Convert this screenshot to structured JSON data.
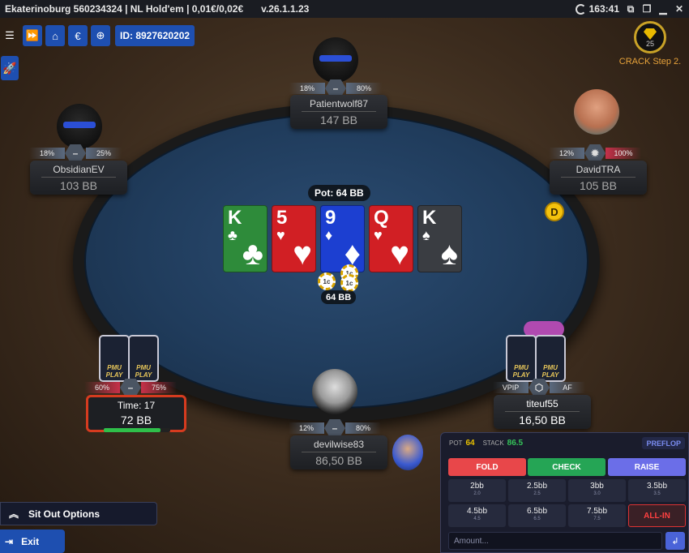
{
  "window": {
    "title": "Ekaterinoburg 560234324 | NL Hold'em | 0,01€/0,02€",
    "version": "v.26.1.1.23",
    "clock": "163:41"
  },
  "toolbar": {
    "id_label": "ID: 8927620202"
  },
  "crack": {
    "level": "25",
    "label": "CRACK Step 2."
  },
  "pot": {
    "label": "Pot: 64 BB",
    "chips_label": "64 BB",
    "chip_denom": "1c"
  },
  "board": [
    {
      "rank": "K",
      "suit": "♣",
      "color": "green"
    },
    {
      "rank": "5",
      "suit": "♥",
      "color": "red"
    },
    {
      "rank": "9",
      "suit": "♦",
      "color": "blue"
    },
    {
      "rank": "Q",
      "suit": "♥",
      "color": "red"
    },
    {
      "rank": "K",
      "suit": "♠",
      "color": "dark"
    }
  ],
  "dealer_button": "D",
  "seats": {
    "top": {
      "name": "Patientwolf87",
      "stack": "147 BB",
      "vpip": "18%",
      "af": "80%"
    },
    "left": {
      "name": "ObsidianEV",
      "stack": "103 BB",
      "vpip": "18%",
      "af": "25%"
    },
    "right": {
      "name": "DavidTRA",
      "stack": "105 BB",
      "vpip": "12%",
      "af": "100%"
    },
    "bottom_left": {
      "time": "Time: 17",
      "stack": "72 BB",
      "vpip": "60%",
      "af": "75%",
      "card_brand": "PMU PLAY",
      "time_remaining": 0.85
    },
    "bottom_right": {
      "name": "titeuf55",
      "stack": "16,50 BB",
      "vpip_tag": "VPIP",
      "af_tag": "AF",
      "card_brand": "PMU PLAY"
    },
    "hero": {
      "name": "devilwise83",
      "stack": "86,50 BB",
      "vpip": "12%",
      "af": "80%"
    }
  },
  "left_controls": {
    "sit_out": "Sit Out Options",
    "exit": "Exit"
  },
  "action_panel": {
    "pot_label": "POT",
    "pot_value": "64",
    "stack_label": "STACK",
    "stack_value": "86.5",
    "street": "PREFLOP",
    "fold": "FOLD",
    "check": "CHECK",
    "raise": "RAISE",
    "sizes": [
      {
        "label": "2bb",
        "value": "2.0"
      },
      {
        "label": "2.5bb",
        "value": "2.5"
      },
      {
        "label": "3bb",
        "value": "3.0"
      },
      {
        "label": "3.5bb",
        "value": "3.5"
      },
      {
        "label": "4.5bb",
        "value": "4.5"
      },
      {
        "label": "6.5bb",
        "value": "6.5"
      },
      {
        "label": "7.5bb",
        "value": "7.5"
      }
    ],
    "allin": "ALL-IN",
    "amount_placeholder": "Amount..."
  },
  "colors": {
    "felt": "#203c5c",
    "fold": "#e8474a",
    "check": "#25a555",
    "raise": "#6b6ee8",
    "accent": "#1e4fb0"
  }
}
